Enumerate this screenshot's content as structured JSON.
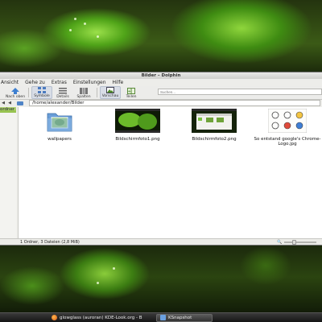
{
  "window": {
    "title": "Bilder – Dolphin"
  },
  "menu": [
    "Ansicht",
    "Gehe zu",
    "Extras",
    "Einstellungen",
    "Hilfe"
  ],
  "menu_underline": [
    "A",
    "G",
    "E",
    "E",
    "H"
  ],
  "toolbar": {
    "buttons": [
      {
        "label": "Nach oben",
        "icon": "up-arrow-icon"
      },
      {
        "label": "Symbole",
        "icon": "icons-view-icon",
        "active": true
      },
      {
        "label": "Details",
        "icon": "details-view-icon"
      },
      {
        "label": "Spalten",
        "icon": "columns-view-icon"
      },
      {
        "label": "Vorschau",
        "icon": "preview-icon",
        "active": true
      },
      {
        "label": "Teilen",
        "icon": "split-icon"
      }
    ],
    "search_placeholder": "Suchen..."
  },
  "location": {
    "path": "/home/alexander/Bilder"
  },
  "sidebar": {
    "items": [
      {
        "label": "ordner"
      }
    ]
  },
  "files": [
    {
      "name": "wallpapers",
      "type": "folder"
    },
    {
      "name": "Bildschirmfoto1.png",
      "type": "image"
    },
    {
      "name": "Bildschirmfoto2.png",
      "type": "image"
    },
    {
      "name": "So entstand google's Chrome-Logo.jpg",
      "type": "image"
    }
  ],
  "status": {
    "text": "1 Ordner, 3 Dateien (2,8 MiB)"
  },
  "taskbar": {
    "tasks": [
      {
        "label": "glowglass (auroran) KDE-Look.org - B",
        "icon": "firefox-icon"
      },
      {
        "label": "KSnapshot",
        "icon": "ksnapshot-icon"
      }
    ]
  },
  "colors": {
    "accent": "#8fbe45",
    "selection": "#d8dde6"
  }
}
